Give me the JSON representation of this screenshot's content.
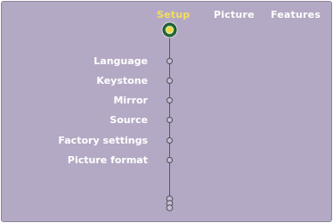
{
  "tabs": [
    {
      "label": "Setup",
      "active": true
    },
    {
      "label": "Picture",
      "active": false
    },
    {
      "label": "Features",
      "active": false
    }
  ],
  "menu": {
    "items": [
      {
        "label": "Language"
      },
      {
        "label": "Keystone"
      },
      {
        "label": "Mirror"
      },
      {
        "label": "Source"
      },
      {
        "label": "Factory settings"
      },
      {
        "label": "Picture format"
      }
    ]
  },
  "colors": {
    "background": "#b4a9c4",
    "active_tab": "#f4dd5c",
    "text": "#ffffff",
    "top_node_ring": "#2a6b3a",
    "top_node_center": "#f0d83a"
  },
  "icons": {
    "top_node": "setup-selector-icon",
    "menu_node": "menu-node-icon"
  }
}
